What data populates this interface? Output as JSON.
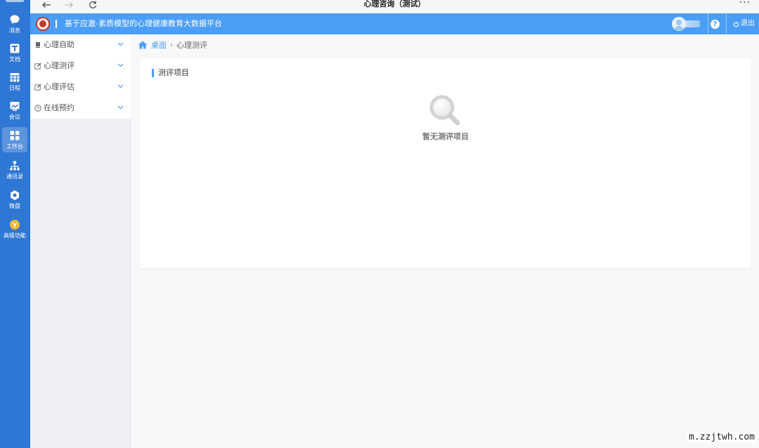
{
  "window": {
    "title": "心理咨询（测试）",
    "more": "···"
  },
  "rail": {
    "items": [
      {
        "label": "消息",
        "icon": "message-icon"
      },
      {
        "label": "文档",
        "icon": "document-icon"
      },
      {
        "label": "日程",
        "icon": "calendar-icon"
      },
      {
        "label": "会议",
        "icon": "meeting-icon"
      },
      {
        "label": "工作台",
        "icon": "workbench-icon",
        "active": true
      },
      {
        "label": "通讯录",
        "icon": "contacts-icon"
      },
      {
        "label": "微盘",
        "icon": "cloud-drive-icon"
      },
      {
        "label": "高级功能",
        "icon": "advanced-icon"
      }
    ]
  },
  "header": {
    "title": "基于应激-素质模型的心理健康教育大数据平台",
    "help": "?",
    "logout": "退出"
  },
  "sidebar": {
    "items": [
      {
        "label": "心理自助",
        "icon": "book-icon"
      },
      {
        "label": "心理测评",
        "icon": "edit-icon"
      },
      {
        "label": "心理评估",
        "icon": "edit-icon"
      },
      {
        "label": "在线预约",
        "icon": "clock-icon"
      }
    ]
  },
  "breadcrumb": {
    "home": "桌面",
    "separator": "›",
    "current": "心理测评"
  },
  "card": {
    "title": "测评项目",
    "empty_text": "暂无测评项目"
  },
  "watermark": "m.zzjtwh.com",
  "colors": {
    "rail": "#2f77d4",
    "header": "#4a9ef5",
    "accent": "#4a9ef5"
  }
}
